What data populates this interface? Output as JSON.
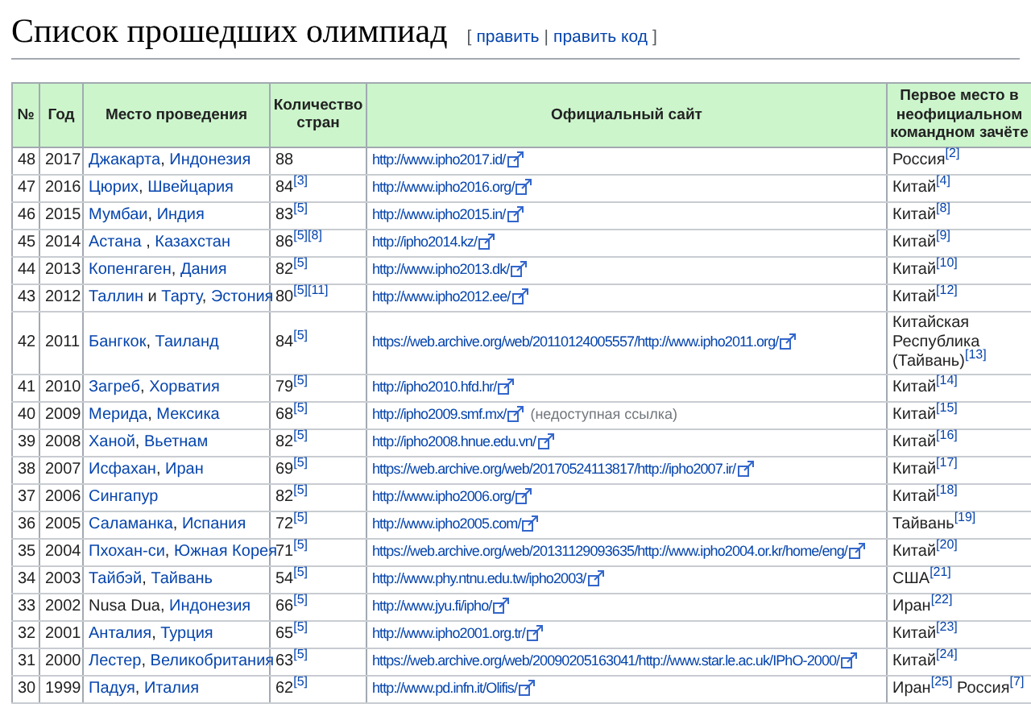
{
  "heading": {
    "title": "Список прошедших олимпиад",
    "edit": {
      "open": "[",
      "links": [
        "править",
        "править код"
      ],
      "divider": "|",
      "close": "]"
    }
  },
  "table": {
    "columns": [
      "№",
      "Год",
      "Место проведения",
      "Количество стран",
      "Официальный сайт",
      "Первое место в неофициальном командном зачёте"
    ],
    "rows": [
      {
        "no": "48",
        "year": "2017",
        "place": [
          {
            "text": "Джакарта",
            "link": true
          },
          {
            "text": ", ",
            "link": false
          },
          {
            "text": "Индонезия",
            "link": true
          }
        ],
        "countries": "88",
        "site": {
          "url": "http://www.ipho2017.id/"
        },
        "winner": "Россия$^{[2]}$"
      },
      {
        "no": "47",
        "year": "2016",
        "place": [
          {
            "text": "Цюрих",
            "link": true
          },
          {
            "text": ", ",
            "link": false
          },
          {
            "text": "Швейцария",
            "link": true
          }
        ],
        "countries": "84$^{[3]}$",
        "site": {
          "url": "http://www.ipho2016.org/"
        },
        "winner": "Китай$^{[4]}$"
      },
      {
        "no": "46",
        "year": "2015",
        "place": [
          {
            "text": "Мумбаи",
            "link": true
          },
          {
            "text": ", ",
            "link": false
          },
          {
            "text": "Индия",
            "link": true
          }
        ],
        "countries": "83$^{[5]}$",
        "site": {
          "url": "http://www.ipho2015.in/"
        },
        "winner": "Китай$^{[8]}$"
      },
      {
        "no": "45",
        "year": "2014",
        "place": [
          {
            "text": "Астана",
            "link": true
          },
          {
            "text": " , ",
            "link": false
          },
          {
            "text": "Казахстан",
            "link": true
          }
        ],
        "countries": "86$^{[5][8]}$",
        "site": {
          "url": "http://ipho2014.kz/"
        },
        "winner": "Китай$^{[9]}$"
      },
      {
        "no": "44",
        "year": "2013",
        "place": [
          {
            "text": "Копенгаген",
            "link": true
          },
          {
            "text": ", ",
            "link": false
          },
          {
            "text": "Дания",
            "link": true
          }
        ],
        "countries": "82$^{[5]}$",
        "site": {
          "url": "http://www.ipho2013.dk/"
        },
        "winner": "Китай$^{[10]}$"
      },
      {
        "no": "43",
        "year": "2012",
        "place": [
          {
            "text": "Таллин",
            "link": true
          },
          {
            "text": " и ",
            "link": false
          },
          {
            "text": "Тарту",
            "link": true
          },
          {
            "text": ", ",
            "link": false
          },
          {
            "text": "Эстония",
            "link": true
          }
        ],
        "countries": "80$^{[5][11]}$",
        "site": {
          "url": "http://www.ipho2012.ee/"
        },
        "winner": "Китай$^{[12]}$"
      },
      {
        "no": "42",
        "year": "2011",
        "place": [
          {
            "text": "Бангкок",
            "link": true
          },
          {
            "text": ", ",
            "link": false
          },
          {
            "text": "Таиланд",
            "link": true
          }
        ],
        "countries": "84$^{[5]}$",
        "site": {
          "url": "https://web.archive.org/web/20110124005557/http://www.ipho2011.org/"
        },
        "winner": "Китайская Республика (Тайвань)$^{[13]}$"
      },
      {
        "no": "41",
        "year": "2010",
        "place": [
          {
            "text": "Загреб",
            "link": true
          },
          {
            "text": ", ",
            "link": false
          },
          {
            "text": "Хорватия",
            "link": true
          }
        ],
        "countries": "79$^{[5]}$",
        "site": {
          "url": "http://ipho2010.hfd.hr/"
        },
        "winner": "Китай$^{[14]}$"
      },
      {
        "no": "40",
        "year": "2009",
        "place": [
          {
            "text": "Мерида",
            "link": true
          },
          {
            "text": ", ",
            "link": false
          },
          {
            "text": "Мексика",
            "link": true
          }
        ],
        "countries": "68$^{[5]}$",
        "site": {
          "url": "http://ipho2009.smf.mx/",
          "note": "(недоступная ссылка)"
        },
        "winner": "Китай$^{[15]}$"
      },
      {
        "no": "39",
        "year": "2008",
        "place": [
          {
            "text": "Ханой",
            "link": true
          },
          {
            "text": ", ",
            "link": false
          },
          {
            "text": "Вьетнам",
            "link": true
          }
        ],
        "countries": "82$^{[5]}$",
        "site": {
          "url": "http://ipho2008.hnue.edu.vn/"
        },
        "winner": "Китай$^{[16]}$"
      },
      {
        "no": "38",
        "year": "2007",
        "place": [
          {
            "text": "Исфахан",
            "link": true
          },
          {
            "text": ", ",
            "link": false
          },
          {
            "text": "Иран",
            "link": true
          }
        ],
        "countries": "69$^{[5]}$",
        "site": {
          "url": "https://web.archive.org/web/20170524113817/http://ipho2007.ir/"
        },
        "winner": "Китай$^{[17]}$"
      },
      {
        "no": "37",
        "year": "2006",
        "place": [
          {
            "text": "Сингапур",
            "link": true
          }
        ],
        "countries": "82$^{[5]}$",
        "site": {
          "url": "http://www.ipho2006.org/"
        },
        "winner": "Китай$^{[18]}$"
      },
      {
        "no": "36",
        "year": "2005",
        "place": [
          {
            "text": "Саламанка",
            "link": true
          },
          {
            "text": ", ",
            "link": false
          },
          {
            "text": "Испания",
            "link": true
          }
        ],
        "countries": "72$^{[5]}$",
        "site": {
          "url": "http://www.ipho2005.com/"
        },
        "winner": "Тайвань$^{[19]}$"
      },
      {
        "no": "35",
        "year": "2004",
        "place": [
          {
            "text": "Пхохан-си",
            "link": true
          },
          {
            "text": ", ",
            "link": false
          },
          {
            "text": "Южная Корея",
            "link": true
          }
        ],
        "countries": "71$^{[5]}$",
        "site": {
          "url": "https://web.archive.org/web/20131129093635/http://www.ipho2004.or.kr/home/eng/"
        },
        "winner": "Китай$^{[20]}$"
      },
      {
        "no": "34",
        "year": "2003",
        "place": [
          {
            "text": "Тайбэй",
            "link": true
          },
          {
            "text": ", ",
            "link": false
          },
          {
            "text": "Тайвань",
            "link": true
          }
        ],
        "countries": "54$^{[5]}$",
        "site": {
          "url": "http://www.phy.ntnu.edu.tw/ipho2003/"
        },
        "winner": "США$^{[21]}$"
      },
      {
        "no": "33",
        "year": "2002",
        "place": [
          {
            "text": "Nusa Dua",
            "link": false
          },
          {
            "text": ", ",
            "link": false
          },
          {
            "text": "Индонезия",
            "link": true
          }
        ],
        "countries": "66$^{[5]}$",
        "site": {
          "url": "http://www.jyu.fi/ipho/"
        },
        "winner": "Иран$^{[22]}$"
      },
      {
        "no": "32",
        "year": "2001",
        "place": [
          {
            "text": "Анталия",
            "link": true
          },
          {
            "text": ", ",
            "link": false
          },
          {
            "text": "Турция",
            "link": true
          }
        ],
        "countries": "65$^{[5]}$",
        "site": {
          "url": "http://www.ipho2001.org.tr/"
        },
        "winner": "Китай$^{[23]}$"
      },
      {
        "no": "31",
        "year": "2000",
        "place": [
          {
            "text": "Лестер",
            "link": true
          },
          {
            "text": ", ",
            "link": false
          },
          {
            "text": "Великобритания",
            "link": true
          }
        ],
        "countries": "63$^{[5]}$",
        "site": {
          "url": "https://web.archive.org/web/20090205163041/http://www.star.le.ac.uk/IPhO-2000/"
        },
        "winner": "Китай$^{[24]}$"
      },
      {
        "no": "30",
        "year": "1999",
        "place": [
          {
            "text": "Падуя",
            "link": true
          },
          {
            "text": ", ",
            "link": false
          },
          {
            "text": "Италия",
            "link": true
          }
        ],
        "countries": "62$^{[5]}$",
        "site": {
          "url": "http://www.pd.infn.it/Olifis/"
        },
        "winner": "Иран$^{[25]}$ Россия$^{[7]}$"
      }
    ]
  }
}
